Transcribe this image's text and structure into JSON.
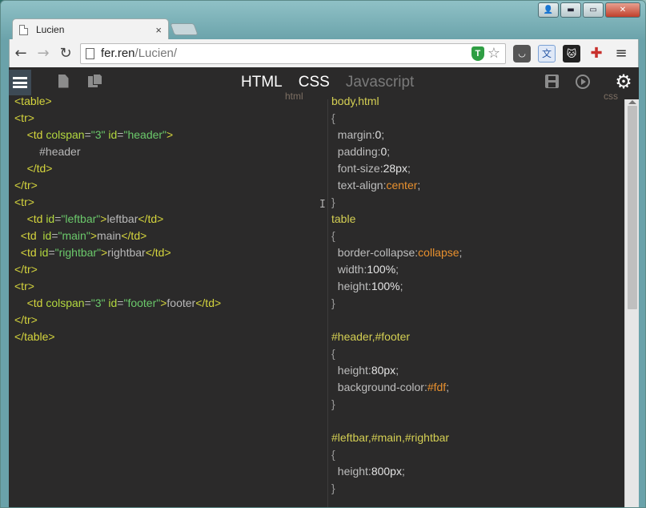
{
  "window": {
    "controls": {
      "user": "👤",
      "minimize": "▬",
      "maximize": "▭",
      "close": "✕"
    }
  },
  "tab": {
    "title": "Lucien",
    "close": "×"
  },
  "toolbar": {
    "back": "←",
    "forward": "→",
    "reload": "↻",
    "url_host": "fer.ren",
    "url_path": "/Lucien/",
    "shield": "T",
    "star": "☆",
    "ext_pocket": "◡",
    "ext_translate": "文",
    "ext_cat": "🐱",
    "ext_puzzle": "✚",
    "menu": "≡"
  },
  "editor": {
    "tabs": {
      "html": "HTML",
      "css": "CSS",
      "js": "Javascript"
    },
    "labels": {
      "html": "html",
      "css": "css"
    },
    "gear": "⚙",
    "cursor": "I"
  },
  "html_code": [
    [
      {
        "c": "tg",
        "t": "<table>"
      }
    ],
    [
      {
        "c": "tg",
        "t": "<tr>"
      }
    ],
    [
      {
        "c": "tx",
        "t": "    "
      },
      {
        "c": "tg",
        "t": "<td "
      },
      {
        "c": "at",
        "t": "colspan"
      },
      {
        "c": "tx",
        "t": "="
      },
      {
        "c": "st",
        "t": "\"3\""
      },
      {
        "c": "tx",
        "t": " "
      },
      {
        "c": "at",
        "t": "id"
      },
      {
        "c": "tx",
        "t": "="
      },
      {
        "c": "st",
        "t": "\"header\""
      },
      {
        "c": "tg",
        "t": ">"
      }
    ],
    [
      {
        "c": "tx",
        "t": "        #header"
      }
    ],
    [
      {
        "c": "tx",
        "t": "    "
      },
      {
        "c": "tg",
        "t": "</td>"
      }
    ],
    [
      {
        "c": "tg",
        "t": "</tr>"
      }
    ],
    [
      {
        "c": "tg",
        "t": "<tr>"
      }
    ],
    [
      {
        "c": "tx",
        "t": "    "
      },
      {
        "c": "tg",
        "t": "<td "
      },
      {
        "c": "at",
        "t": "id"
      },
      {
        "c": "tx",
        "t": "="
      },
      {
        "c": "st",
        "t": "\"leftbar\""
      },
      {
        "c": "tg",
        "t": ">"
      },
      {
        "c": "tx",
        "t": "leftbar"
      },
      {
        "c": "tg",
        "t": "</td>"
      }
    ],
    [
      {
        "c": "tx",
        "t": "  "
      },
      {
        "c": "tg",
        "t": "<td  "
      },
      {
        "c": "at",
        "t": "id"
      },
      {
        "c": "tx",
        "t": "="
      },
      {
        "c": "st",
        "t": "\"main\""
      },
      {
        "c": "tg",
        "t": ">"
      },
      {
        "c": "tx",
        "t": "main"
      },
      {
        "c": "tg",
        "t": "</td>"
      }
    ],
    [
      {
        "c": "tx",
        "t": "  "
      },
      {
        "c": "tg",
        "t": "<td "
      },
      {
        "c": "at",
        "t": "id"
      },
      {
        "c": "tx",
        "t": "="
      },
      {
        "c": "st",
        "t": "\"rightbar\""
      },
      {
        "c": "tg",
        "t": ">"
      },
      {
        "c": "tx",
        "t": "rightbar"
      },
      {
        "c": "tg",
        "t": "</td>"
      }
    ],
    [
      {
        "c": "tg",
        "t": "</tr>"
      }
    ],
    [
      {
        "c": "tg",
        "t": "<tr>"
      }
    ],
    [
      {
        "c": "tx",
        "t": "    "
      },
      {
        "c": "tg",
        "t": "<td "
      },
      {
        "c": "at",
        "t": "colspan"
      },
      {
        "c": "tx",
        "t": "="
      },
      {
        "c": "st",
        "t": "\"3\""
      },
      {
        "c": "tx",
        "t": " "
      },
      {
        "c": "at",
        "t": "id"
      },
      {
        "c": "tx",
        "t": "="
      },
      {
        "c": "st",
        "t": "\"footer\""
      },
      {
        "c": "tg",
        "t": ">"
      },
      {
        "c": "tx",
        "t": "footer"
      },
      {
        "c": "tg",
        "t": "</td>"
      }
    ],
    [
      {
        "c": "tg",
        "t": "</tr>"
      }
    ],
    [
      {
        "c": "tg",
        "t": "</table>"
      }
    ]
  ],
  "css_code": [
    [
      {
        "c": "sel",
        "t": "body,html"
      }
    ],
    [
      {
        "c": "br",
        "t": "{"
      }
    ],
    [
      {
        "c": "pr",
        "t": "  margin:"
      },
      {
        "c": "vl",
        "t": "0"
      },
      {
        "c": "pr",
        "t": ";"
      }
    ],
    [
      {
        "c": "pr",
        "t": "  padding:"
      },
      {
        "c": "vl",
        "t": "0"
      },
      {
        "c": "pr",
        "t": ";"
      }
    ],
    [
      {
        "c": "pr",
        "t": "  font-size:"
      },
      {
        "c": "vl",
        "t": "28px"
      },
      {
        "c": "pr",
        "t": ";"
      }
    ],
    [
      {
        "c": "pr",
        "t": "  text-align:"
      },
      {
        "c": "kw",
        "t": "center"
      },
      {
        "c": "pr",
        "t": ";"
      }
    ],
    [
      {
        "c": "br",
        "t": "}"
      }
    ],
    [
      {
        "c": "sel",
        "t": "table"
      }
    ],
    [
      {
        "c": "br",
        "t": "{"
      }
    ],
    [
      {
        "c": "pr",
        "t": "  border-collapse:"
      },
      {
        "c": "kw",
        "t": "collapse"
      },
      {
        "c": "pr",
        "t": ";"
      }
    ],
    [
      {
        "c": "pr",
        "t": "  width:"
      },
      {
        "c": "vl",
        "t": "100%"
      },
      {
        "c": "pr",
        "t": ";"
      }
    ],
    [
      {
        "c": "pr",
        "t": "  height:"
      },
      {
        "c": "vl",
        "t": "100%"
      },
      {
        "c": "pr",
        "t": ";"
      }
    ],
    [
      {
        "c": "br",
        "t": "}"
      }
    ],
    [
      {
        "c": "tx",
        "t": ""
      }
    ],
    [
      {
        "c": "sel",
        "t": "#header,#footer"
      }
    ],
    [
      {
        "c": "br",
        "t": "{"
      }
    ],
    [
      {
        "c": "pr",
        "t": "  height:"
      },
      {
        "c": "vl",
        "t": "80px"
      },
      {
        "c": "pr",
        "t": ";"
      }
    ],
    [
      {
        "c": "pr",
        "t": "  background-color:"
      },
      {
        "c": "kw",
        "t": "#fdf"
      },
      {
        "c": "pr",
        "t": ";"
      }
    ],
    [
      {
        "c": "br",
        "t": "}"
      }
    ],
    [
      {
        "c": "tx",
        "t": ""
      }
    ],
    [
      {
        "c": "sel",
        "t": "#leftbar,#main,#rightbar"
      }
    ],
    [
      {
        "c": "br",
        "t": "{"
      }
    ],
    [
      {
        "c": "pr",
        "t": "  height:"
      },
      {
        "c": "vl",
        "t": "800px"
      },
      {
        "c": "pr",
        "t": ";"
      }
    ],
    [
      {
        "c": "br",
        "t": "}"
      }
    ]
  ]
}
